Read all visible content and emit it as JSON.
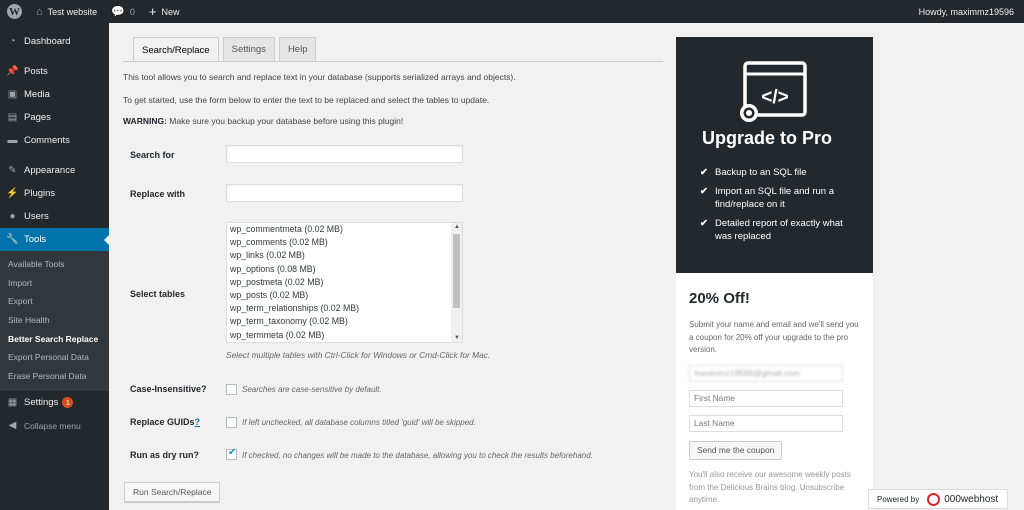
{
  "adminbar": {
    "site_name": "Test website",
    "comments_count": "0",
    "new_label": "New",
    "howdy": "Howdy, maximmz19596"
  },
  "sidebar": {
    "items": [
      {
        "label": "Dashboard",
        "icon": "dashboard-icon"
      },
      {
        "label": "Posts",
        "icon": "pin-icon"
      },
      {
        "label": "Media",
        "icon": "media-icon"
      },
      {
        "label": "Pages",
        "icon": "page-icon"
      },
      {
        "label": "Comments",
        "icon": "comment-icon"
      },
      {
        "label": "Appearance",
        "icon": "brush-icon"
      },
      {
        "label": "Plugins",
        "icon": "plug-icon"
      },
      {
        "label": "Users",
        "icon": "user-icon"
      },
      {
        "label": "Tools",
        "icon": "wrench-icon"
      }
    ],
    "submenu": [
      "Available Tools",
      "Import",
      "Export",
      "Site Health",
      "Better Search Replace",
      "Export Personal Data",
      "Erase Personal Data"
    ],
    "settings_label": "Settings",
    "settings_badge": "1",
    "collapse_label": "Collapse menu"
  },
  "tabs": [
    "Search/Replace",
    "Settings",
    "Help"
  ],
  "intro": {
    "line1": "This tool allows you to search and replace text in your database (supports serialized arrays and objects).",
    "line2": "To get started, use the form below to enter the text to be replaced and select the tables to update.",
    "warning_label": "WARNING:",
    "warning_text": " Make sure you backup your database before using this plugin!"
  },
  "form": {
    "search_label": "Search for",
    "replace_label": "Replace with",
    "tables_label": "Select tables",
    "tables": [
      "wp_commentmeta (0.02 MB)",
      "wp_comments (0.02 MB)",
      "wp_links (0.02 MB)",
      "wp_options (0.08 MB)",
      "wp_postmeta (0.02 MB)",
      "wp_posts (0.02 MB)",
      "wp_term_relationships (0.02 MB)",
      "wp_term_taxonomy (0.02 MB)",
      "wp_termmeta (0.02 MB)"
    ],
    "tables_hint": "Select multiple tables with Ctrl-Click for Windows or Cmd-Click for Mac.",
    "case_label": "Case-Insensitive?",
    "case_hint": "Searches are case-sensitive by default.",
    "guid_label": "Replace GUIDs",
    "guid_link": "?",
    "guid_hint": "If left unchecked, all database columns titled 'guid' will be skipped.",
    "dry_label": "Run as dry run?",
    "dry_hint": "If checked, no changes will be made to the database, allowing you to check the results beforehand.",
    "dry_checked": true,
    "run_button": "Run Search/Replace"
  },
  "promo": {
    "title": "Upgrade to Pro",
    "points": [
      "Backup to an SQL file",
      "Import an SQL file and run a find/replace on it",
      "Detailed report of exactly what was replaced"
    ],
    "coupon_title": "20% Off!",
    "coupon_desc": "Submit your name and email and we'll send you a coupon for 20% off your upgrade to the pro version.",
    "email_value": "maximmz19596@gmail.com",
    "first_name_placeholder": "First Name",
    "last_name_placeholder": "Last Name",
    "coupon_button": "Send me the coupon",
    "coupon_foot": "You'll also receive our awesome weekly posts from the Delicious Brains blog. Unsubscribe anytime."
  },
  "powered": {
    "label": "Powered by",
    "brand": "000webhost"
  },
  "colors": {
    "accent": "#0073aa",
    "adminbar_bg": "#23282d",
    "notification": "#d54e21"
  }
}
